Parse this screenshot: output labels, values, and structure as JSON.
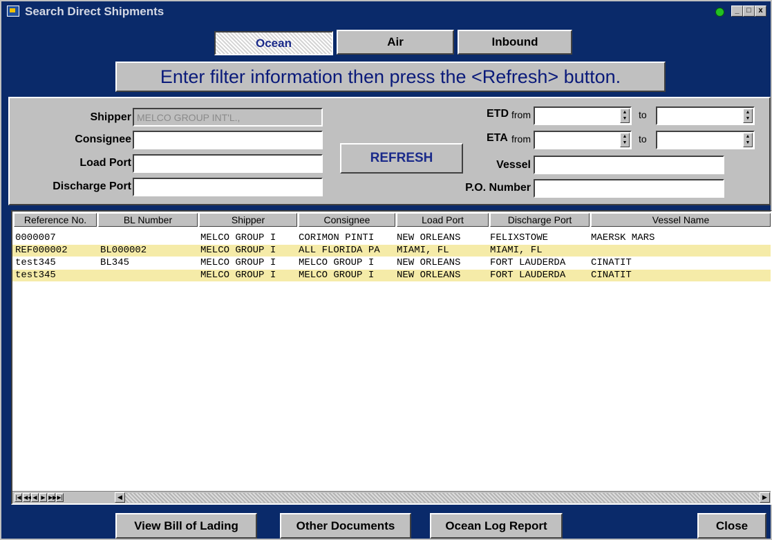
{
  "window": {
    "title": "Search Direct Shipments",
    "controls": {
      "minimize": "_",
      "maximize": "□",
      "close": "x"
    }
  },
  "tabs": [
    {
      "label": "Ocean",
      "active": true
    },
    {
      "label": "Air",
      "active": false
    },
    {
      "label": "Inbound",
      "active": false
    }
  ],
  "banner": "Enter filter information then press the <Refresh> button.",
  "filters": {
    "shipper": {
      "label": "Shipper",
      "value": "MELCO GROUP INT'L.,"
    },
    "consignee": {
      "label": "Consignee",
      "value": ""
    },
    "load_port": {
      "label": "Load Port",
      "value": ""
    },
    "discharge_port": {
      "label": "Discharge Port",
      "value": ""
    },
    "etd": {
      "label": "ETD",
      "from_label": "from",
      "to_label": "to",
      "from_value": "",
      "to_value": ""
    },
    "eta": {
      "label": "ETA",
      "from_label": "from",
      "to_label": "to",
      "from_value": "",
      "to_value": ""
    },
    "vessel": {
      "label": "Vessel",
      "value": ""
    },
    "po_number": {
      "label": "P.O. Number",
      "value": ""
    },
    "refresh_label": "REFRESH"
  },
  "grid": {
    "columns": [
      "Reference No.",
      "BL Number",
      "Shipper",
      "Consignee",
      "Load Port",
      "Discharge Port",
      "Vessel Name"
    ],
    "rows": [
      [
        "0000007",
        "",
        "MELCO GROUP I",
        "CORIMON  PINTI",
        "NEW ORLEANS",
        "FELIXSTOWE",
        " MAERSK MARS"
      ],
      [
        "REF000002",
        "BL000002",
        "MELCO GROUP I",
        "ALL FLORIDA PA",
        "MIAMI, FL",
        "MIAMI, FL",
        ""
      ],
      [
        "test345",
        "BL345",
        "MELCO GROUP I",
        "MELCO GROUP I",
        "NEW ORLEANS",
        "FORT LAUDERDA",
        "CINATIT"
      ],
      [
        "test345",
        "",
        "MELCO GROUP I",
        "MELCO GROUP I",
        "NEW ORLEANS",
        "FORT LAUDERDA",
        "CINATIT"
      ]
    ]
  },
  "footer": {
    "view_bol": "View Bill of Lading",
    "other_docs": "Other Documents",
    "ocean_log": "Ocean Log Report",
    "close": "Close"
  },
  "colors": {
    "window_bg": "#0a2a6a",
    "face": "#c0c0c0",
    "row_alt": "#f5eba8",
    "banner_text": "#0a1a7a",
    "status_indicator": "#22c022"
  },
  "icons": [
    "app-icon",
    "status-indicator-icon",
    "spin-up-icon",
    "spin-down-icon",
    "first-record-icon",
    "prev-page-icon",
    "prev-record-icon",
    "next-record-icon",
    "next-page-icon",
    "last-record-icon",
    "scroll-left-icon",
    "scroll-right-icon"
  ]
}
